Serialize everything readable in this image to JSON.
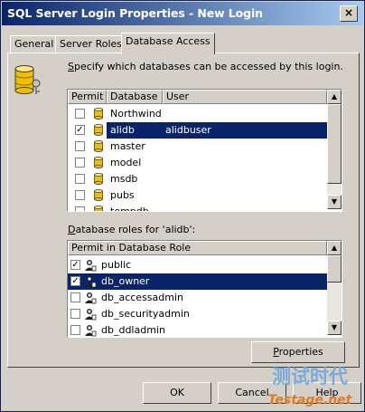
{
  "window": {
    "title": "SQL Server Login Properties - New Login",
    "close_glyph": "×"
  },
  "tabs": [
    {
      "label": "General",
      "active": false
    },
    {
      "label": "Server Roles",
      "active": false
    },
    {
      "label": "Database Access",
      "active": true
    }
  ],
  "instruction": {
    "first": "S",
    "rest": "pecify which databases can be accessed by this login."
  },
  "db_table": {
    "headers": [
      "Permit",
      "Database",
      "User"
    ],
    "rows": [
      {
        "checked": false,
        "database": "Northwind",
        "user": "",
        "selected": false
      },
      {
        "checked": true,
        "database": "alidb",
        "user": "alidbuser",
        "selected": true
      },
      {
        "checked": false,
        "database": "master",
        "user": "",
        "selected": false
      },
      {
        "checked": false,
        "database": "model",
        "user": "",
        "selected": false
      },
      {
        "checked": false,
        "database": "msdb",
        "user": "",
        "selected": false
      },
      {
        "checked": false,
        "database": "pubs",
        "user": "",
        "selected": false
      },
      {
        "checked": false,
        "database": "tempdb",
        "user": "",
        "selected": false
      }
    ]
  },
  "roles_label": {
    "first": "D",
    "rest": "atabase roles for 'alidb':"
  },
  "roles_table": {
    "header": "Permit in Database Role",
    "rows": [
      {
        "checked": true,
        "role": "public",
        "selected": false
      },
      {
        "checked": true,
        "role": "db_owner",
        "selected": true
      },
      {
        "checked": false,
        "role": "db_accessadmin",
        "selected": false
      },
      {
        "checked": false,
        "role": "db_securityadmin",
        "selected": false
      },
      {
        "checked": false,
        "role": "db_ddladmin",
        "selected": false
      }
    ]
  },
  "buttons": {
    "properties": {
      "first": "P",
      "rest": "roperties"
    },
    "ok": "OK",
    "cancel": "Cancel",
    "help": "Help"
  },
  "watermark": {
    "text": "测试时代",
    "url": "Testage.net"
  },
  "colors": {
    "title_start": "#0a246a",
    "title_end": "#a6caf0",
    "selection": "#0a246a",
    "face": "#d4d0c8"
  }
}
